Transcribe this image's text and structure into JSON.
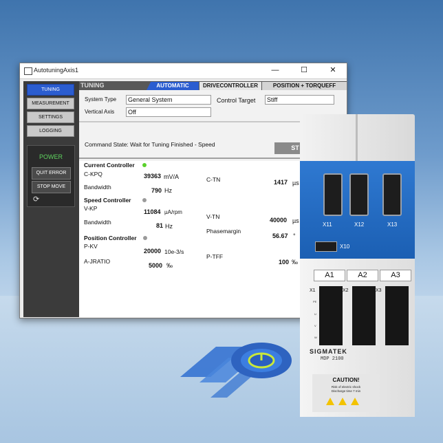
{
  "window": {
    "title": "AutotuningAxis1",
    "controls": {
      "minimize": "—",
      "maximize": "☐",
      "close": "✕"
    }
  },
  "nav": {
    "items": [
      {
        "label": "TUNING",
        "active": true
      },
      {
        "label": "MEASUREMENT",
        "active": false
      },
      {
        "label": "SETTINGS",
        "active": false
      },
      {
        "label": "LOGGING",
        "active": false
      }
    ]
  },
  "power_panel": {
    "label": "POWER",
    "quit_error": "QUIT ERROR",
    "stop_move": "STOP MOVE"
  },
  "main": {
    "section_title": "TUNING",
    "tabs": [
      {
        "label": "AUTOMATIC",
        "active": true
      },
      {
        "label": "DRIVECONTROLLER",
        "active": false
      },
      {
        "label": "POSITION + TORQUEFF",
        "active": false
      }
    ],
    "system_type": {
      "label": "System Type",
      "value": "General System"
    },
    "control_target": {
      "label": "Control Target",
      "value": "Stiff"
    },
    "vertical_axis": {
      "label": "Vertical Axis",
      "value": "Off"
    },
    "command_state": "Command State: Wait for Tuning Finished - Speed",
    "start_button": "ST"
  },
  "current_controller": {
    "title": "Current Controller",
    "status_color": "#5ad12b",
    "ckpq": {
      "label": "C-KPQ",
      "value": "39363",
      "unit": "mV/A"
    },
    "bandwidth": {
      "label": "Bandwidth",
      "value": "790",
      "unit": "Hz"
    },
    "ctn": {
      "label": "C-TN",
      "value": "1417",
      "unit": "µs"
    }
  },
  "speed_controller": {
    "title": "Speed Controller",
    "status_color": "#9a9a9a",
    "vkp": {
      "label": "V-KP",
      "value": "11084",
      "unit": "µA/rpm"
    },
    "bandwidth": {
      "label": "Bandwidth",
      "value": "81",
      "unit": "Hz"
    },
    "vtn": {
      "label": "V-TN",
      "value": "40000",
      "unit": "µs"
    },
    "phasemargin": {
      "label": "Phasemargin",
      "value": "56.67",
      "unit": "°"
    }
  },
  "position_controller": {
    "title": "Position Controller",
    "status_color": "#9a9a9a",
    "pkv": {
      "label": "P-KV",
      "value": "20000",
      "unit": "10e-3/s"
    },
    "ajratio": {
      "label": "A-JRATIO",
      "value": "5000",
      "unit": "‰"
    },
    "ptff": {
      "label": "P-TFF",
      "value": "100",
      "unit": "‰"
    }
  },
  "device": {
    "connectors": [
      "X11",
      "X12",
      "X13"
    ],
    "port": "X10",
    "axes": [
      "A1",
      "A2",
      "A3"
    ],
    "terminals": [
      "X1",
      "X2",
      "X3"
    ],
    "pins": [
      "PE",
      "U",
      "V",
      "W"
    ],
    "brand": "SIGMATEK",
    "model": "MDP 2100",
    "caution_title": "CAUTION!",
    "caution_line1": "Risk of electric shock",
    "caution_line2": "Discharge time 7 min"
  }
}
